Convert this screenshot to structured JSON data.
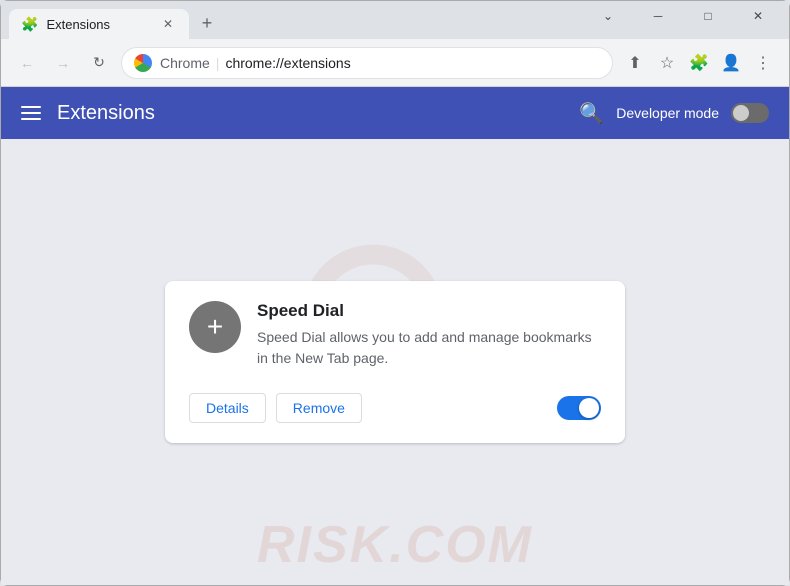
{
  "window": {
    "title": "Extensions",
    "controls": {
      "minimize": "─",
      "maximize": "□",
      "close": "✕",
      "chevron": "⌄"
    }
  },
  "tab": {
    "icon": "🧩",
    "title": "Extensions",
    "close": "✕"
  },
  "new_tab_btn": "+",
  "toolbar": {
    "back": "←",
    "forward": "→",
    "reload": "↻",
    "address_chrome": "Chrome",
    "address_separator": "|",
    "address_url": "chrome://extensions",
    "share_icon": "⬆",
    "bookmark_icon": "☆",
    "puzzle_icon": "🧩",
    "profile_icon": "👤",
    "menu_icon": "⋮"
  },
  "ext_header": {
    "title": "Extensions",
    "search_icon": "🔍",
    "dev_mode_label": "Developer mode"
  },
  "extension": {
    "name": "Speed Dial",
    "description": "Speed Dial allows you to add and manage bookmarks in the New Tab page.",
    "details_btn": "Details",
    "remove_btn": "Remove",
    "enabled": true
  },
  "watermark": {
    "text": "RISK.COM"
  }
}
